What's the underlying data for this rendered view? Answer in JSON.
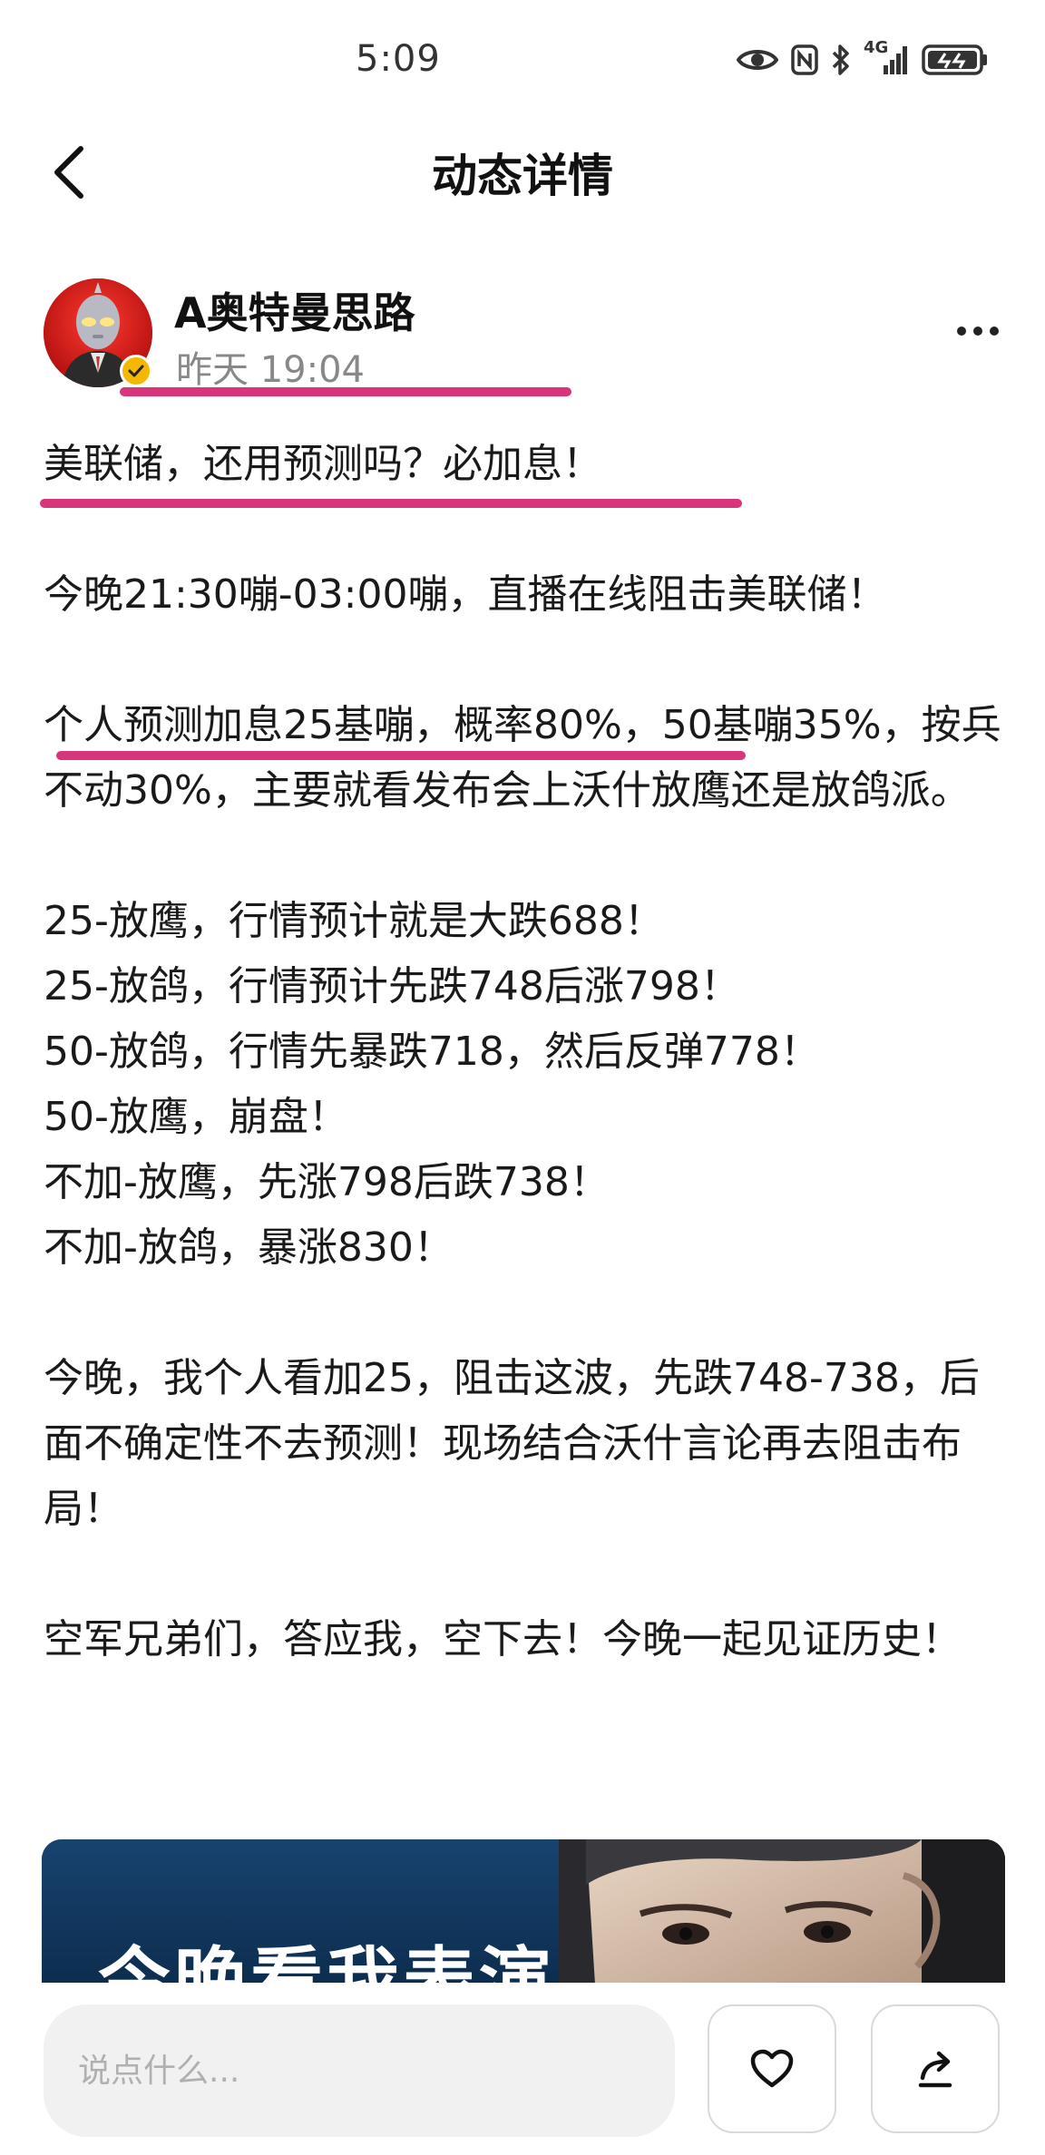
{
  "status_bar": {
    "time": "5:09",
    "icons": [
      "eye-icon",
      "nfc-icon",
      "bluetooth-icon",
      "signal-4g-icon",
      "battery-saver-icon"
    ],
    "network_label": "4G"
  },
  "nav": {
    "title": "动态详情",
    "back_icon": "chevron-left-icon"
  },
  "author": {
    "name": "A奥特曼思路",
    "time": "昨天 19:04",
    "verified": true
  },
  "post": {
    "paragraphs": [
      "美联储，还用预测吗？必加息！",
      "",
      "今晚21:30嘣-03:00嘣，直播在线阻击美联储！",
      "",
      "个人预测加息25基嘣，概率80%，50基嘣35%，按兵不动30%，主要就看发布会上沃什放鹰还是放鸽派。",
      "",
      "25-放鹰，行情预计就是大跌688！",
      "25-放鸽，行情预计先跌748后涨798！",
      "50-放鸽，行情先暴跌718，然后反弹778！",
      "50-放鹰，崩盘！",
      "不加-放鹰，先涨798后跌738！",
      "不加-放鸽，暴涨830！",
      "",
      "今晚，我个人看加25，阻击这波，先跌748-738，后面不确定性不去预测！现场结合沃什言论再去阻击布局！",
      "",
      "空军兄弟们，答应我，空下去！今晚一起见证历史！"
    ],
    "image_text": "今晚看我表演"
  },
  "bottom_bar": {
    "comment_placeholder": "说点什么...",
    "like_icon": "heart-icon",
    "share_icon": "share-icon"
  },
  "colors": {
    "highlight": "#d9357a",
    "verify_badge": "#f5b800",
    "banner_bg": "#12355c"
  }
}
